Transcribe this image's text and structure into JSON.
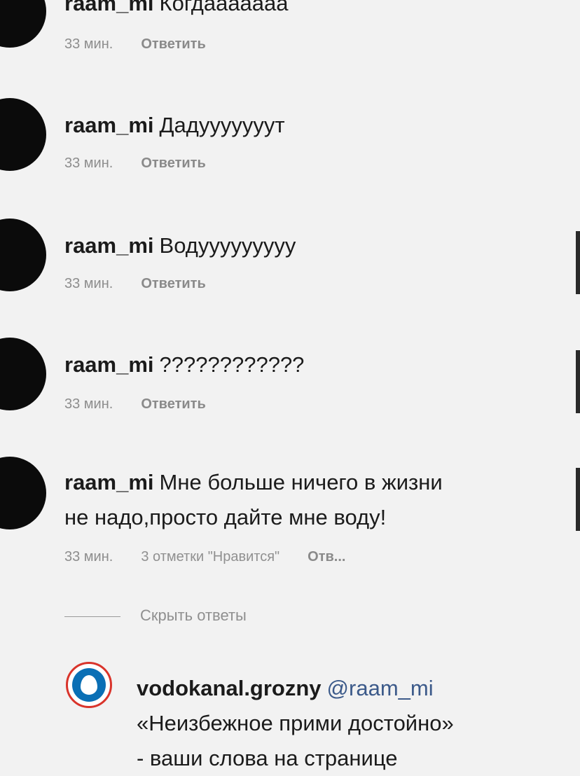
{
  "comments": [
    {
      "user": "raam_mi",
      "text": "Когдааааааа",
      "meta": {
        "time": "33 мин.",
        "reply": "Ответить"
      }
    },
    {
      "user": "raam_mi",
      "text": "Дадууууууут",
      "meta": {
        "time": "33 мин.",
        "reply": "Ответить"
      }
    },
    {
      "user": "raam_mi",
      "text": "Водууууууууу",
      "meta": {
        "time": "33 мин.",
        "reply": "Ответить"
      }
    },
    {
      "user": "raam_mi",
      "text": "????????????",
      "meta": {
        "time": "33 мин.",
        "reply": "Ответить"
      }
    },
    {
      "user": "raam_mi",
      "text_line1": "Мне больше ничего в жизни",
      "text_line2": "не надо,просто дайте мне воду!",
      "meta": {
        "time": "33 мин.",
        "likes": "3 отметки \"Нравится\"",
        "reply": "Отв..."
      }
    }
  ],
  "hide_replies": "Скрыть ответы",
  "reply": {
    "user": "vodokanal.grozny",
    "mention": "@raam_mi",
    "line2": "«Неизбежное прими достойно»",
    "line3": "- ваши слова на странице"
  }
}
